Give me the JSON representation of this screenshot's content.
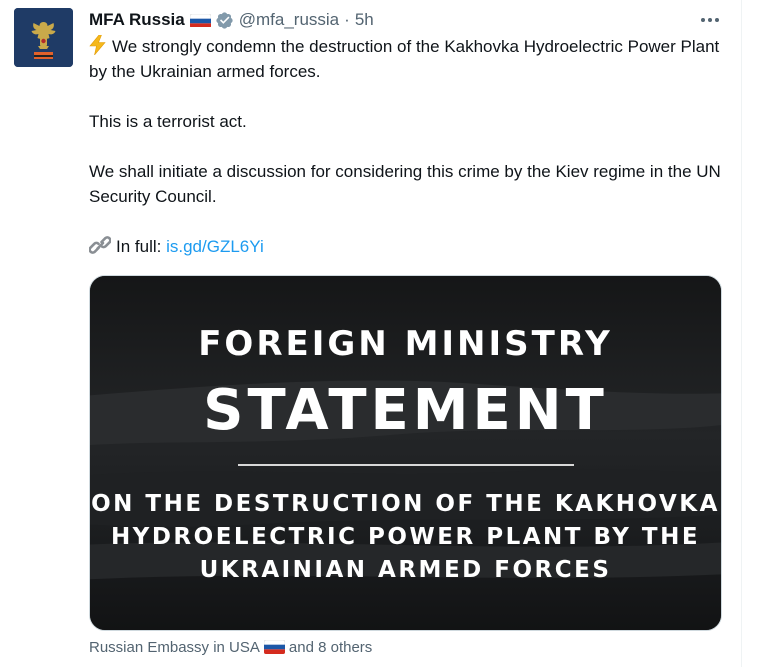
{
  "tweet": {
    "display_name": "MFA Russia",
    "handle": "@mfa_russia",
    "separator": "·",
    "time": "5h",
    "paragraphs": {
      "p1": "We strongly condemn the destruction of the Kakhovka Hydroelectric Power Plant by the Ukrainian armed forces.",
      "p2": "This is a terrorist act.",
      "p3": "We shall initiate a discussion for considering this crime by the Kiev regime in the UN Security Council.",
      "link_prefix": "In full:",
      "link_text": "is.gd/GZL6Yi"
    },
    "icons": {
      "bolt": "high-voltage-emoji",
      "link": "link-emoji",
      "flag": "russia-flag",
      "verified": "verified-badge",
      "more": "more-horizontal-icon"
    }
  },
  "media": {
    "line1": "FOREIGN MINISTRY",
    "line2": "STATEMENT",
    "sub1": "ON THE DESTRUCTION OF THE KAKHOVKA",
    "sub2": "HYDROELECTRIC POWER PLANT BY THE",
    "sub3": "UKRAINIAN ARMED FORCES"
  },
  "social_context": {
    "account": "Russian Embassy in USA",
    "suffix": "and 8 others"
  },
  "colors": {
    "text": "#0f1419",
    "secondary": "#536471",
    "link": "#1d9bf0",
    "verified": "#829aab"
  }
}
